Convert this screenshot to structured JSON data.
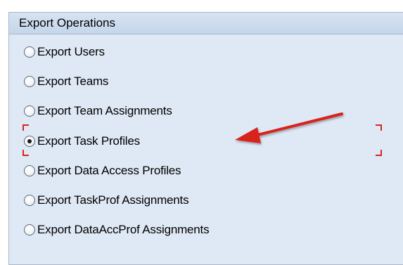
{
  "panel": {
    "title": "Export Operations"
  },
  "options": [
    {
      "label": "Export Users",
      "checked": false
    },
    {
      "label": "Export Teams",
      "checked": false
    },
    {
      "label": "Export Team Assignments",
      "checked": false
    },
    {
      "label": "Export Task Profiles",
      "checked": true
    },
    {
      "label": "Export Data Access Profiles",
      "checked": false
    },
    {
      "label": "Export TaskProf Assignments",
      "checked": false
    },
    {
      "label": "Export DataAccProf Assignments",
      "checked": false
    }
  ],
  "colors": {
    "panel_background": "#dfe9f5",
    "header_background": "#c5d6ea",
    "annotation_red": "#d9241c"
  },
  "annotation": {
    "icon": "red-arrow-icon",
    "target": "Export Task Profiles"
  }
}
